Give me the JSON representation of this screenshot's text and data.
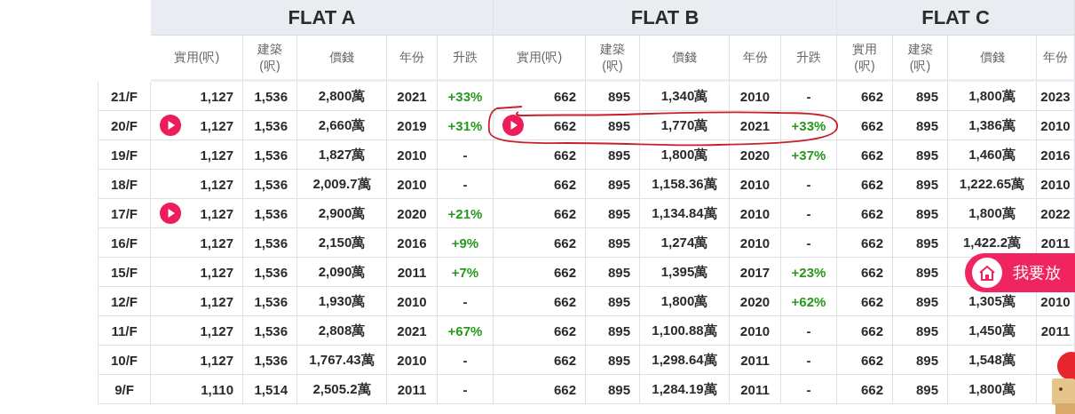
{
  "flats": [
    {
      "name": "FLAT A",
      "columns": [
        "實用(呎)",
        "建築\n(呎)",
        "價錢",
        "年份",
        "升跌"
      ]
    },
    {
      "name": "FLAT B",
      "columns": [
        "實用(呎)",
        "建築\n(呎)",
        "價錢",
        "年份",
        "升跌"
      ]
    },
    {
      "name": "FLAT C",
      "columns": [
        "實用\n(呎)",
        "建築\n(呎)",
        "價錢",
        "年份"
      ]
    }
  ],
  "rows": [
    {
      "floor": "21/F",
      "flats": [
        {
          "cells": [
            "1,127",
            "1,536",
            "2,800萬",
            "2021",
            "+33%"
          ],
          "video": false,
          "rising": true,
          "circled": false
        },
        {
          "cells": [
            "662",
            "895",
            "1,340萬",
            "2010",
            "-"
          ],
          "video": false,
          "rising": false,
          "circled": false
        },
        {
          "cells": [
            "662",
            "895",
            "1,800萬",
            "2023"
          ],
          "video": false,
          "circled": false
        }
      ]
    },
    {
      "floor": "20/F",
      "flats": [
        {
          "cells": [
            "1,127",
            "1,536",
            "2,660萬",
            "2019",
            "+31%"
          ],
          "video": true,
          "rising": true,
          "circled": false
        },
        {
          "cells": [
            "662",
            "895",
            "1,770萬",
            "2021",
            "+33%"
          ],
          "video": true,
          "rising": true,
          "circled": true
        },
        {
          "cells": [
            "662",
            "895",
            "1,386萬",
            "2010"
          ],
          "video": false,
          "circled": false
        }
      ]
    },
    {
      "floor": "19/F",
      "flats": [
        {
          "cells": [
            "1,127",
            "1,536",
            "1,827萬",
            "2010",
            "-"
          ],
          "video": false,
          "rising": false,
          "circled": false
        },
        {
          "cells": [
            "662",
            "895",
            "1,800萬",
            "2020",
            "+37%"
          ],
          "video": false,
          "rising": true,
          "circled": false
        },
        {
          "cells": [
            "662",
            "895",
            "1,460萬",
            "2016"
          ],
          "video": false,
          "circled": false
        }
      ]
    },
    {
      "floor": "18/F",
      "flats": [
        {
          "cells": [
            "1,127",
            "1,536",
            "2,009.7萬",
            "2010",
            "-"
          ],
          "video": false,
          "rising": false,
          "circled": false
        },
        {
          "cells": [
            "662",
            "895",
            "1,158.36萬",
            "2010",
            "-"
          ],
          "video": false,
          "rising": false,
          "circled": false
        },
        {
          "cells": [
            "662",
            "895",
            "1,222.65萬",
            "2010"
          ],
          "video": false,
          "circled": false
        }
      ]
    },
    {
      "floor": "17/F",
      "flats": [
        {
          "cells": [
            "1,127",
            "1,536",
            "2,900萬",
            "2020",
            "+21%"
          ],
          "video": true,
          "rising": true,
          "circled": false
        },
        {
          "cells": [
            "662",
            "895",
            "1,134.84萬",
            "2010",
            "-"
          ],
          "video": false,
          "rising": false,
          "circled": false
        },
        {
          "cells": [
            "662",
            "895",
            "1,800萬",
            "2022"
          ],
          "video": false,
          "circled": false
        }
      ]
    },
    {
      "floor": "16/F",
      "flats": [
        {
          "cells": [
            "1,127",
            "1,536",
            "2,150萬",
            "2016",
            "+9%"
          ],
          "video": false,
          "rising": true,
          "circled": false
        },
        {
          "cells": [
            "662",
            "895",
            "1,274萬",
            "2010",
            "-"
          ],
          "video": false,
          "rising": false,
          "circled": false
        },
        {
          "cells": [
            "662",
            "895",
            "1,422.2萬",
            "2011"
          ],
          "video": false,
          "circled": false
        }
      ]
    },
    {
      "floor": "15/F",
      "flats": [
        {
          "cells": [
            "1,127",
            "1,536",
            "2,090萬",
            "2011",
            "+7%"
          ],
          "video": false,
          "rising": true,
          "circled": false
        },
        {
          "cells": [
            "662",
            "895",
            "1,395萬",
            "2017",
            "+23%"
          ],
          "video": false,
          "rising": true,
          "circled": false
        },
        {
          "cells": [
            "662",
            "895"
          ],
          "video": false,
          "circled": false
        }
      ]
    },
    {
      "floor": "12/F",
      "flats": [
        {
          "cells": [
            "1,127",
            "1,536",
            "1,930萬",
            "2010",
            "-"
          ],
          "video": false,
          "rising": false,
          "circled": false
        },
        {
          "cells": [
            "662",
            "895",
            "1,800萬",
            "2020",
            "+62%"
          ],
          "video": false,
          "rising": true,
          "circled": false
        },
        {
          "cells": [
            "662",
            "895",
            "1,305萬",
            "2010"
          ],
          "video": false,
          "circled": false
        }
      ]
    },
    {
      "floor": "11/F",
      "flats": [
        {
          "cells": [
            "1,127",
            "1,536",
            "2,808萬",
            "2021",
            "+67%"
          ],
          "video": false,
          "rising": true,
          "circled": false
        },
        {
          "cells": [
            "662",
            "895",
            "1,100.88萬",
            "2010",
            "-"
          ],
          "video": false,
          "rising": false,
          "circled": false
        },
        {
          "cells": [
            "662",
            "895",
            "1,450萬",
            "2011"
          ],
          "video": false,
          "circled": false
        }
      ]
    },
    {
      "floor": "10/F",
      "flats": [
        {
          "cells": [
            "1,127",
            "1,536",
            "1,767.43萬",
            "2010",
            "-"
          ],
          "video": false,
          "rising": false,
          "circled": false
        },
        {
          "cells": [
            "662",
            "895",
            "1,298.64萬",
            "2011",
            "-"
          ],
          "video": false,
          "rising": false,
          "circled": false
        },
        {
          "cells": [
            "662",
            "895",
            "1,548萬"
          ],
          "video": false,
          "circled": false
        }
      ]
    },
    {
      "floor": "9/F",
      "flats": [
        {
          "cells": [
            "1,110",
            "1,514",
            "2,505.2萬",
            "2011",
            "-"
          ],
          "video": false,
          "rising": false,
          "circled": false
        },
        {
          "cells": [
            "662",
            "895",
            "1,284.19萬",
            "2011",
            "-"
          ],
          "video": false,
          "rising": false,
          "circled": false
        },
        {
          "cells": [
            "662",
            "895",
            "1,800萬"
          ],
          "video": false,
          "circled": false
        }
      ]
    }
  ],
  "floating_button": {
    "label": "我要放"
  }
}
